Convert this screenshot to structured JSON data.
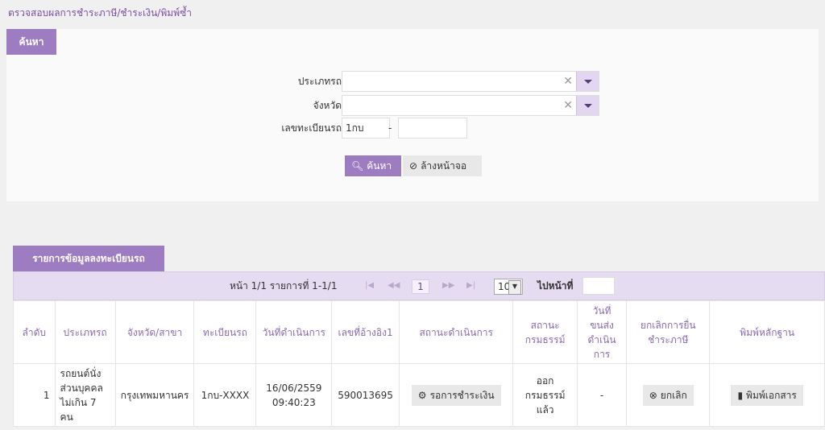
{
  "breadcrumb": "ตรวจสอบผลการชำระภาษี/ชำระเงิน/พิมพ์ซ้ำ",
  "search": {
    "tab_label": "ค้นหา",
    "vehicle_type_label": "ประเภทรถ",
    "province_label": "จังหวัด",
    "plate_label": "เลขทะเบียนรถ",
    "plate_prefix": "1กบ",
    "plate_number": "",
    "dash": "-",
    "search_button": "ค้นหา",
    "clear_button": "ล้างหน้าจอ"
  },
  "list": {
    "tab_label": "รายการข้อมูลลงทะเบียนรถ",
    "pager_text": "หน้า 1/1 รายการที่ 1-1/1",
    "current_page": "1",
    "page_size": "10",
    "goto_label": "ไปหน้าที่",
    "columns": [
      "ลำดับ",
      "ประเภทรถ",
      "จังหวัด/สาขา",
      "ทะเบียนรถ",
      "วันที่ดำเนินการ",
      "เลขที่อ้างอิง1",
      "สถานะดำเนินการ",
      "สถานะกรมธรรม์",
      "วันที่ขนส่งดำเนินการ",
      "ยกเลิกการยื่นชำระภาษี",
      "พิมพ์หลักฐาน"
    ],
    "rows": [
      {
        "no": "1",
        "vehicle_type": "รถยนต์นั่งส่วนบุคคลไม่เกิน 7 คน",
        "province": "กรุงเทพมหานคร",
        "plate": "1กบ-XXXX",
        "date": "16/06/2559 09:40:23",
        "ref": "590013695",
        "status_button": "รอการชำระเงิน",
        "policy_status": "ออกกรมธรรม์แล้ว",
        "transport_date": "-",
        "cancel_button": "ยกเลิก",
        "print_button": "พิมพ์เอกสาร"
      }
    ]
  }
}
